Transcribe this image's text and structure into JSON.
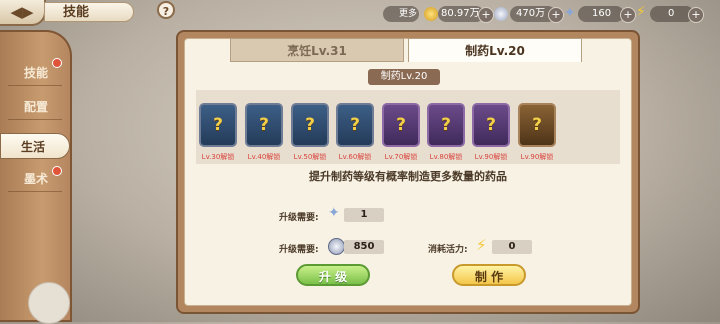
{
  "header": {
    "title": "技能",
    "help": "?"
  },
  "resources": {
    "more_label": "更多",
    "gold": "80.97万",
    "silver": "470万",
    "gems": "160",
    "energy": "0"
  },
  "sidebar": {
    "items": [
      {
        "label": "技能",
        "active": false
      },
      {
        "label": "配置",
        "active": false
      },
      {
        "label": "生活",
        "active": true
      },
      {
        "label": "墨术",
        "active": false
      }
    ]
  },
  "tabs": [
    {
      "label": "烹饪Lv.31",
      "active": false
    },
    {
      "label": "制药Lv.20",
      "active": true
    }
  ],
  "section_title": "制药Lv.20",
  "slots": [
    {
      "unlock": "Lv.30解锁",
      "rarity": "blue"
    },
    {
      "unlock": "Lv.40解锁",
      "rarity": "blue"
    },
    {
      "unlock": "Lv.50解锁",
      "rarity": "blue"
    },
    {
      "unlock": "Lv.60解锁",
      "rarity": "blue"
    },
    {
      "unlock": "Lv.70解锁",
      "rarity": "purple"
    },
    {
      "unlock": "Lv.80解锁",
      "rarity": "purple"
    },
    {
      "unlock": "Lv.90解锁",
      "rarity": "purple"
    },
    {
      "unlock": "Lv.90解锁",
      "rarity": "gold"
    }
  ],
  "description": "提升制药等级有概率制造更多数量的药品",
  "upgrade": {
    "need_label_1": "升级需要:",
    "need_value_1": "1",
    "need_label_2": "升级需要:",
    "need_value_2": "850",
    "energy_label": "消耗活力:",
    "energy_value": "0"
  },
  "buttons": {
    "upgrade": "升 级",
    "make": "制 作"
  },
  "colors": {
    "accent_green": "#7bc04a",
    "accent_gold": "#f3c64a",
    "unlock_red": "#d8433b"
  }
}
